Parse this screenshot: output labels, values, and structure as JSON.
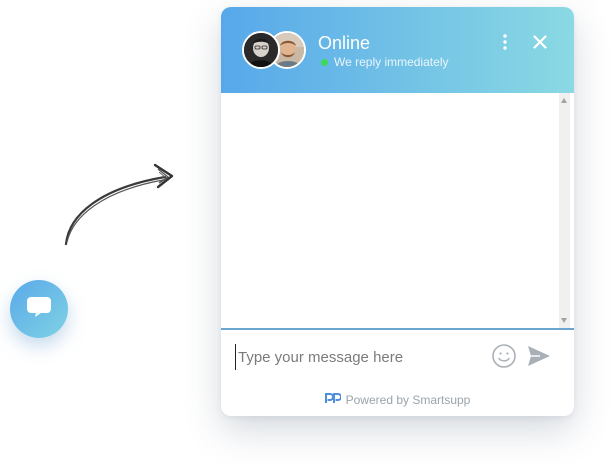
{
  "launcher": {
    "icon": "chat-bubble-icon"
  },
  "decor": {
    "arrow_icon": "hand-drawn-arrow-icon"
  },
  "header": {
    "title": "Online",
    "status_text": "We reply immediately",
    "status_color": "#3ed95b",
    "gradient_start": "#57a8ea",
    "gradient_end": "#8ad9e3",
    "menu_icon": "more-vertical-icon",
    "close_icon": "close-icon",
    "avatars": [
      {
        "name": "agent-avatar-1"
      },
      {
        "name": "agent-avatar-2"
      }
    ]
  },
  "composer": {
    "placeholder": "Type your message here",
    "value": "",
    "emoji_icon": "emoji-icon",
    "send_icon": "send-icon",
    "accent_line_color": "#6aa5cf"
  },
  "footer": {
    "powered_by": "Powered by Smartsupp",
    "brand_icon": "smartsupp-logo-icon"
  }
}
